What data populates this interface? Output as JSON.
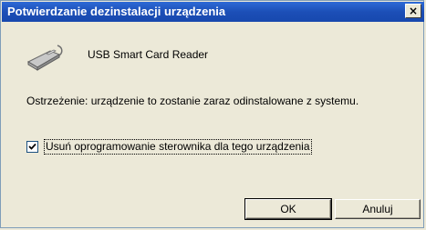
{
  "window": {
    "title": "Potwierdzanie dezinstalacji urządzenia",
    "close_glyph": "×"
  },
  "device": {
    "icon": "card-reader-icon",
    "name": "USB Smart Card Reader"
  },
  "warning_text": "Ostrzeżenie: urządzenie to zostanie zaraz odinstalowane z systemu.",
  "checkbox": {
    "label": "Usuń oprogramowanie sterownika dla tego urządzenia",
    "checked": true
  },
  "buttons": {
    "ok_label": "OK",
    "cancel_label": "Anuluj"
  },
  "colors": {
    "titlebar": "#1c4fb7",
    "dialog_bg": "#ece9d8"
  }
}
